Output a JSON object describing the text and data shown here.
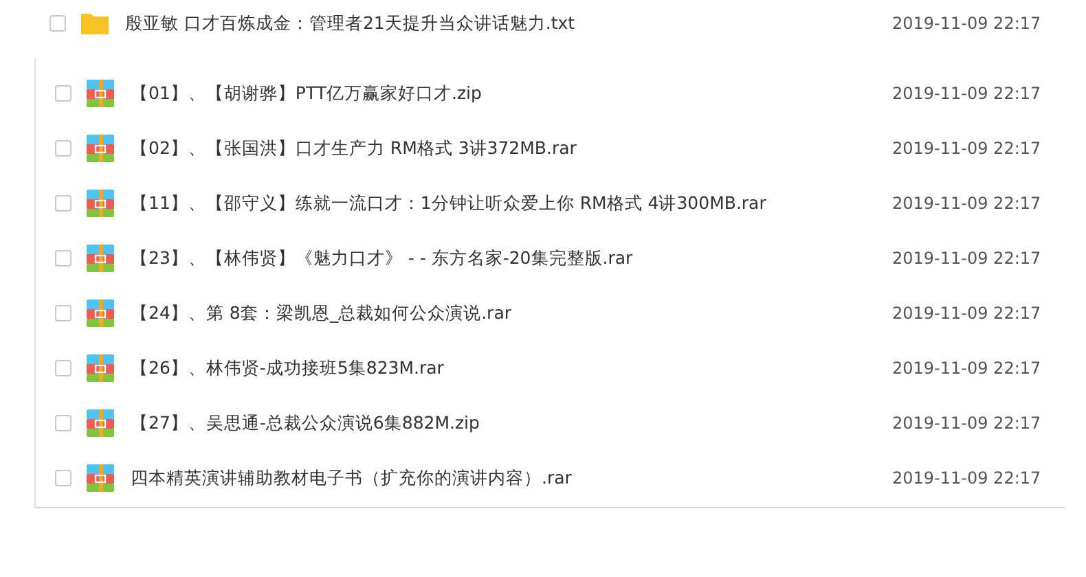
{
  "top_item": {
    "kind": "folder",
    "name": "殷亚敏 口才百炼成金：管理者21天提升当众讲话魅力.txt",
    "date": "2019-11-09 22:17",
    "checked": false
  },
  "files": [
    {
      "kind": "archive",
      "name": "【01】、【胡谢骅】PTT亿万赢家好口才.zip",
      "date": "2019-11-09 22:17",
      "checked": false
    },
    {
      "kind": "archive",
      "name": "【02】、【张国洪】口才生产力 RM格式 3讲372MB.rar",
      "date": "2019-11-09 22:17",
      "checked": false
    },
    {
      "kind": "archive",
      "name": "【11】、【邵守义】练就一流口才：1分钟让听众爱上你 RM格式 4讲300MB.rar",
      "date": "2019-11-09 22:17",
      "checked": false
    },
    {
      "kind": "archive",
      "name": "【23】、【林伟贤】《魅力口才》 - - 东方名家-20集完整版.rar",
      "date": "2019-11-09 22:17",
      "checked": false
    },
    {
      "kind": "archive",
      "name": "【24】、第 8套：梁凯恩_总裁如何公众演说.rar",
      "date": "2019-11-09 22:17",
      "checked": false
    },
    {
      "kind": "archive",
      "name": "【26】、林伟贤-成功接班5集823M.rar",
      "date": "2019-11-09 22:17",
      "checked": false
    },
    {
      "kind": "archive",
      "name": "【27】、吴思通-总裁公众演说6集882M.zip",
      "date": "2019-11-09 22:17",
      "checked": false
    },
    {
      "kind": "archive",
      "name": "四本精英演讲辅助教材电子书（扩充你的演讲内容）.rar",
      "date": "2019-11-09 22:17",
      "checked": false
    }
  ]
}
